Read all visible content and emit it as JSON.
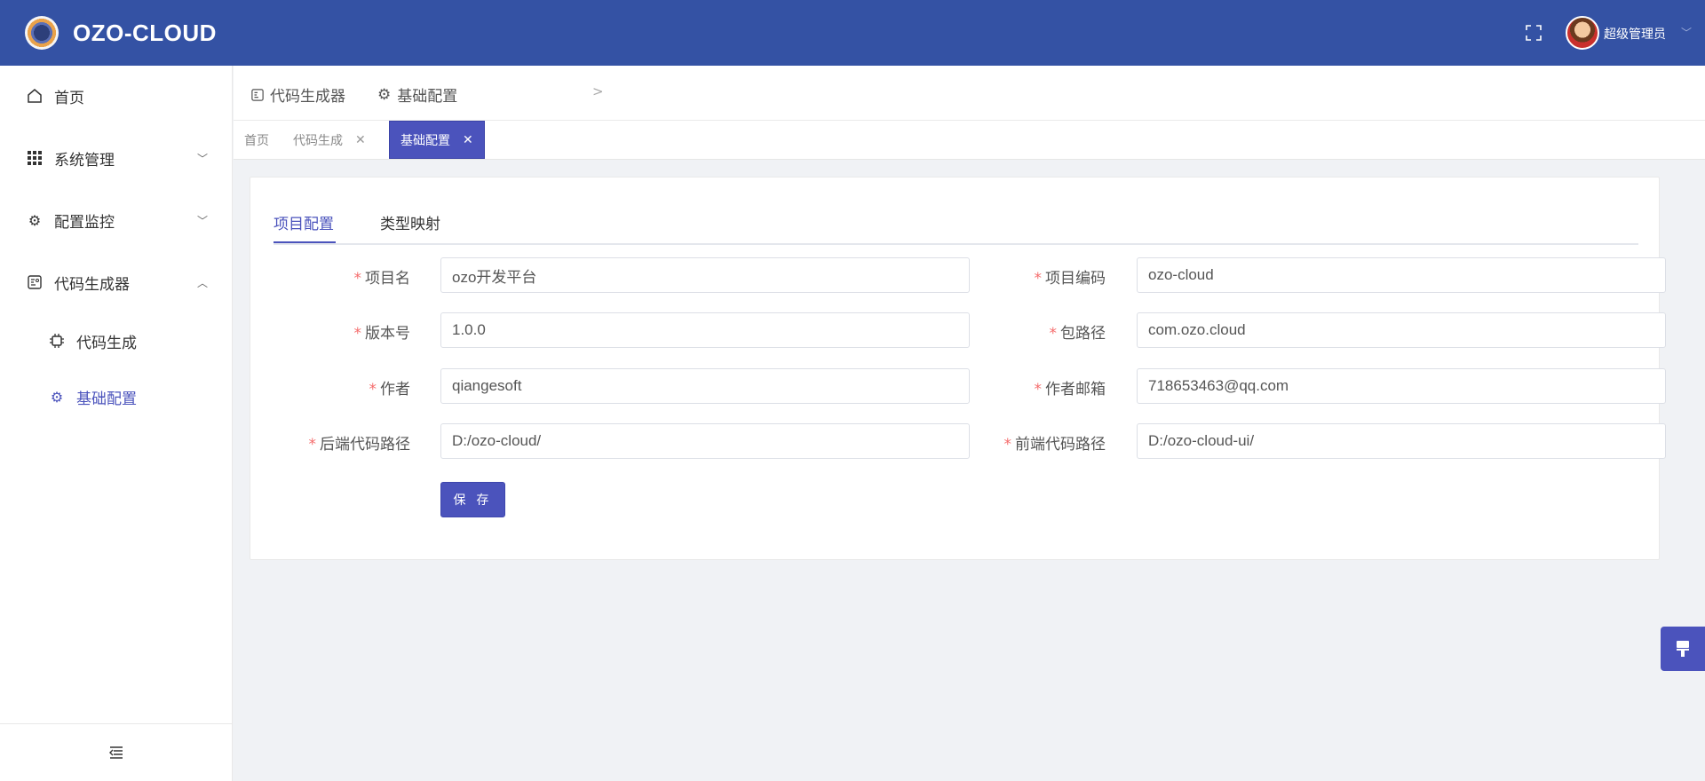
{
  "header": {
    "brand": "OZO-CLOUD",
    "username": "超级管理员",
    "icons": [
      "logo-icon",
      "fullscreen-icon",
      "avatar",
      "chevron-down-icon"
    ]
  },
  "sidebar": {
    "items": [
      {
        "label": "首页",
        "icon": "home-icon"
      },
      {
        "label": "系统管理",
        "icon": "grid-icon"
      },
      {
        "label": "配置监控",
        "icon": "gear-icon"
      },
      {
        "label": "代码生成器",
        "icon": "code-file-icon"
      },
      {
        "label": "代码生成",
        "icon": "chip-icon"
      },
      {
        "label": "基础配置",
        "icon": "gear-icon"
      }
    ],
    "collapse_icon": "collapse-menu-icon"
  },
  "breadcrumb": {
    "parent": "代码生成器",
    "current": "基础配置"
  },
  "tags": [
    {
      "label": "首页"
    },
    {
      "label": "代码生成"
    },
    {
      "label": "基础配置"
    }
  ],
  "tabs": {
    "project": "项目配置",
    "type_mapping": "类型映射"
  },
  "form": {
    "project_name": {
      "label": "项目名",
      "value": "ozo开发平台"
    },
    "project_code": {
      "label": "项目编码",
      "value": "ozo-cloud"
    },
    "version": {
      "label": "版本号",
      "value": "1.0.0"
    },
    "package_path": {
      "label": "包路径",
      "value": "com.ozo.cloud"
    },
    "author": {
      "label": "作者",
      "value": "qiangesoft"
    },
    "author_email": {
      "label": "作者邮箱",
      "value": "718653463@qq.com"
    },
    "backend_path": {
      "label": "后端代码路径",
      "value": "D:/ozo-cloud/"
    },
    "frontend_path": {
      "label": "前端代码路径",
      "value": "D:/ozo-cloud-ui/"
    },
    "save_label": "保 存"
  },
  "colors": {
    "header": "#3452a4",
    "accent": "#4b53bc",
    "required": "#f56c6c"
  }
}
